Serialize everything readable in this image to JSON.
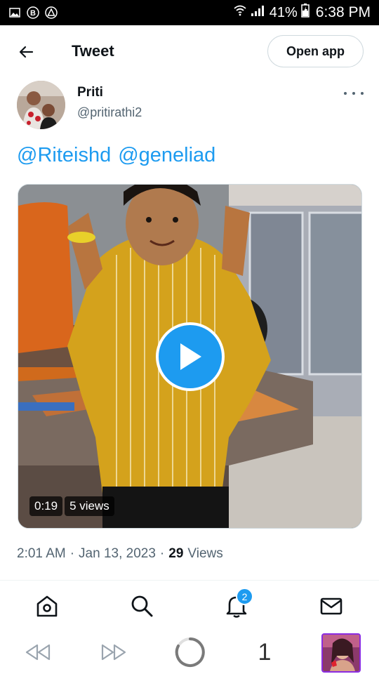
{
  "status_bar": {
    "battery": "41%",
    "time": "6:38 PM"
  },
  "header": {
    "title": "Tweet",
    "open_app_label": "Open app"
  },
  "author": {
    "name": "Priti",
    "handle": "@pritirathi2"
  },
  "tweet": {
    "mentions": [
      "@Riteishd",
      "@geneliad"
    ],
    "video": {
      "duration": "0:19",
      "views": "5 views"
    },
    "meta": {
      "time": "2:01 AM",
      "dot1": "·",
      "date": "Jan 13, 2023",
      "dot2": "·",
      "view_count": "29",
      "views_label": "Views"
    }
  },
  "tabbar": {
    "notifications_badge": "2"
  },
  "browser": {
    "tab_count": "1"
  },
  "colors": {
    "accent": "#1d9bf0",
    "text_primary": "#0f1419",
    "text_secondary": "#536471"
  }
}
